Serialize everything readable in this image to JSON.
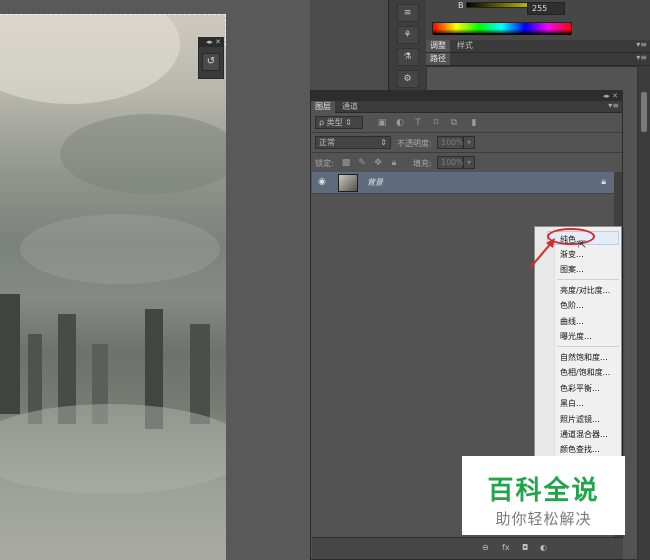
{
  "color_panel": {
    "channel_label": "B",
    "channel_value": "255",
    "spectrum_colors": [
      "#ff0000",
      "#ffff00",
      "#00ff00",
      "#00ffff",
      "#0000ff",
      "#ff00ff"
    ]
  },
  "adjust_panel": {
    "tabs": [
      {
        "label": "调整",
        "active": true
      },
      {
        "label": "样式",
        "active": false
      }
    ],
    "subtabs": [
      {
        "label": "路径"
      }
    ]
  },
  "layers_panel": {
    "tabs": [
      {
        "label": "图层",
        "active": true
      },
      {
        "label": "通道",
        "active": false
      }
    ],
    "filter_kind": "ρ 类型",
    "blend_mode": "正常",
    "opacity_label": "不透明度:",
    "opacity_value": "100%",
    "lock_label": "锁定:",
    "fill_label": "填充:",
    "fill_value": "100%",
    "layer_name": "背景",
    "bottom_icons": [
      "link-icon",
      "fx-icon",
      "mask-icon",
      "adjustment-icon"
    ],
    "bottom_labels": [
      "⊖",
      "fx",
      "◘",
      "◐"
    ]
  },
  "adjust_menu": {
    "groups": [
      [
        "纯色...",
        "渐变...",
        "图案..."
      ],
      [
        "亮度/对比度...",
        "色阶...",
        "曲线...",
        "曝光度..."
      ],
      [
        "自然饱和度...",
        "色相/饱和度...",
        "色彩平衡...",
        "黑白...",
        "照片滤镜...",
        "通道混合器...",
        "颜色查找..."
      ]
    ],
    "highlighted": "纯色..."
  },
  "watermark": {
    "title": "百科全说",
    "subtitle": "助你轻松解决"
  },
  "colors": {
    "accent_highlight": "#d82a2a",
    "watermark_green": "#22a44a"
  }
}
